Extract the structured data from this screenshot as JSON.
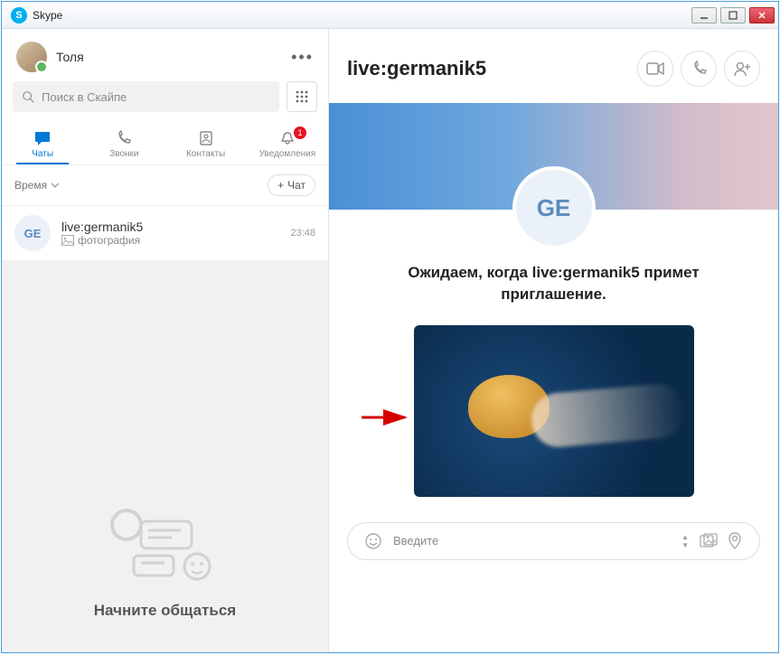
{
  "window": {
    "title": "Skype"
  },
  "user": {
    "name": "Толя"
  },
  "search": {
    "placeholder": "Поиск в Скайпе"
  },
  "tabs": {
    "chats": "Чаты",
    "calls": "Звонки",
    "contacts": "Контакты",
    "notifications": "Уведомления",
    "notif_badge": "1"
  },
  "filter": {
    "label": "Время",
    "new_chat": "Чат"
  },
  "chats": [
    {
      "initials": "GE",
      "name": "live:germanik5",
      "preview": "фотография",
      "time": "23:48"
    }
  ],
  "empty": {
    "text": "Начните общаться"
  },
  "conversation": {
    "title": "live:germanik5",
    "avatar_initials": "GE",
    "invite_text": "Ожидаем, когда live:germanik5 примет приглашение."
  },
  "composer": {
    "placeholder": "Введите"
  }
}
